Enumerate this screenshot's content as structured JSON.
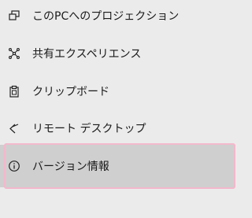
{
  "menu": {
    "items": [
      {
        "label": "このPCへのプロジェクション",
        "icon": "project-to-pc-icon"
      },
      {
        "label": "共有エクスペリエンス",
        "icon": "shared-experiences-icon"
      },
      {
        "label": "クリップボード",
        "icon": "clipboard-icon"
      },
      {
        "label": "リモート デスクトップ",
        "icon": "remote-desktop-icon"
      },
      {
        "label": "バージョン情報",
        "icon": "info-icon"
      }
    ],
    "selected_index": 4
  },
  "colors": {
    "background": "#ebebeb",
    "selected_background": "#cfcfcf",
    "focus_ring": "#f2b8cc",
    "text": "#1a1a1a"
  }
}
